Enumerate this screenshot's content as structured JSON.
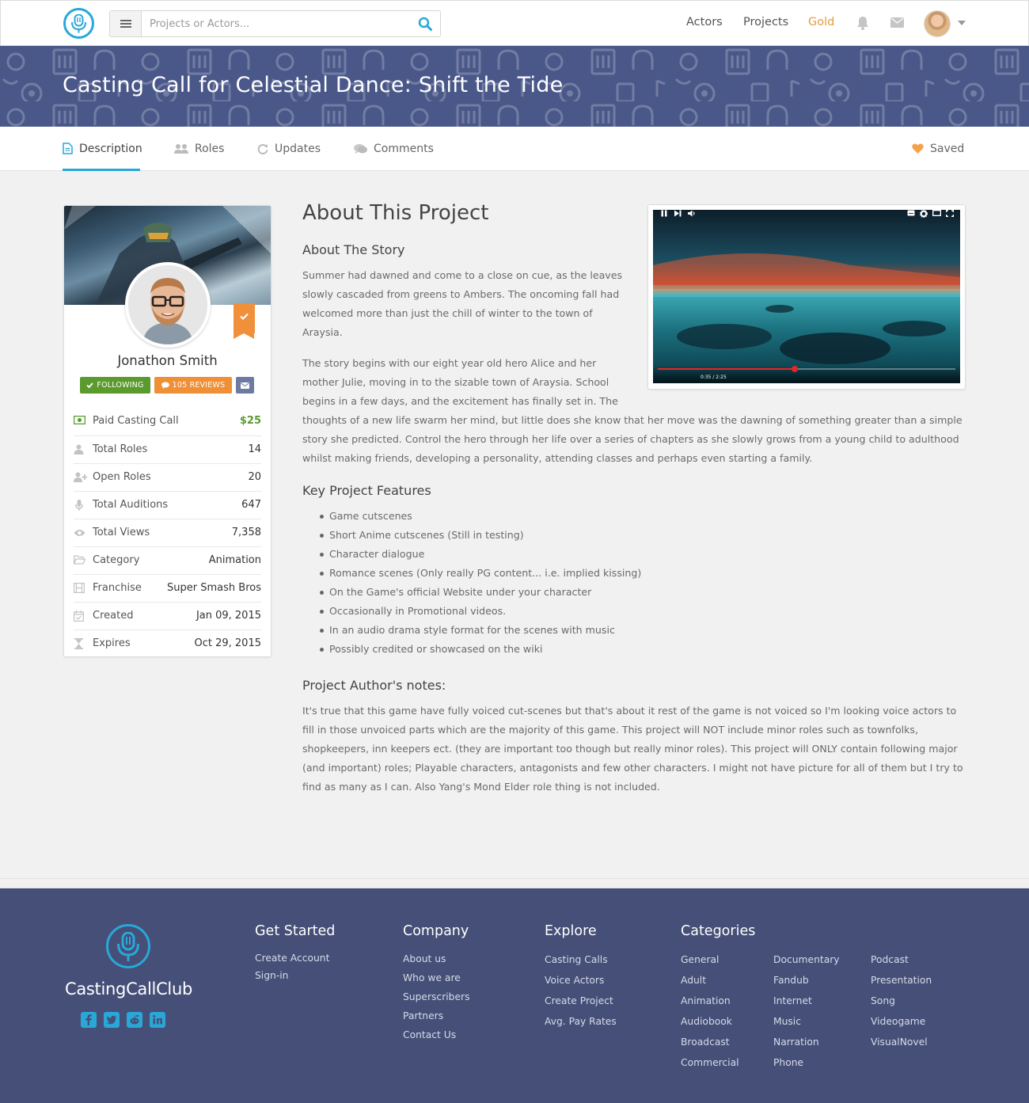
{
  "nav": {
    "search_placeholder": "Projects or Actors...",
    "links": [
      "Actors",
      "Projects",
      "Gold"
    ]
  },
  "banner": {
    "title": "Casting Call for Celestial Dance: Shift the Tide"
  },
  "tabs": [
    {
      "label": "Description",
      "icon": "file-icon",
      "active": true
    },
    {
      "label": "Roles",
      "icon": "users-icon",
      "active": false
    },
    {
      "label": "Updates",
      "icon": "refresh-icon",
      "active": false
    },
    {
      "label": "Comments",
      "icon": "comments-icon",
      "active": false
    }
  ],
  "saved_label": "Saved",
  "profile": {
    "name": "Jonathon Smith",
    "following_label": "FOLLOWING",
    "reviews_label": "105 REVIEWS",
    "stats": [
      {
        "icon": "money-icon",
        "label": "Paid Casting Call",
        "value": "$25"
      },
      {
        "icon": "user-icon",
        "label": "Total Roles",
        "value": "14"
      },
      {
        "icon": "user-plus-icon",
        "label": "Open Roles",
        "value": "20"
      },
      {
        "icon": "microphone-icon",
        "label": "Total Auditions",
        "value": "647"
      },
      {
        "icon": "eye-icon",
        "label": "Total Views",
        "value": "7,358"
      },
      {
        "icon": "folder-icon",
        "label": "Category",
        "value": "Animation"
      },
      {
        "icon": "film-icon",
        "label": "Franchise",
        "value": "Super Smash Bros"
      },
      {
        "icon": "calendar-icon",
        "label": "Created",
        "value": "Jan 09, 2015"
      },
      {
        "icon": "hourglass-icon",
        "label": "Expires",
        "value": "Oct 29, 2015"
      }
    ]
  },
  "content": {
    "title": "About This Project",
    "story_heading": "About The Story",
    "story_p1": "Summer had dawned and come to a close on cue, as the leaves slowly cascaded from greens to Ambers. The oncoming fall had welcomed more than just the chill of winter to the town of Araysia.",
    "story_p2": "The story begins with our eight year old hero Alice and her mother Julie, moving in to the sizable town of Araysia. School begins in a few days, and the excitement has finally set in. The thoughts of a new life swarm her mind, but little does she know that her move was the dawning of something greater than a simple story she predicted. Control the hero through her life over a series of chapters as she slowly grows from a young child to adulthood whilst making friends, developing a personality, attending classes and perhaps even starting a family.",
    "features_heading": "Key Project Features",
    "features": [
      "Game cutscenes",
      "Short Anime cutscenes (Still in testing)",
      "Character dialogue",
      "Romance scenes (Only really PG content... i.e. implied kissing)",
      "On the Game's official Website under your character",
      "Occasionally in Promotional videos.",
      "In an audio drama style format for the scenes with music",
      "Possibly credited or showcased on the wiki"
    ],
    "notes_heading": "Project Author's notes:",
    "notes": "It's true that this game have fully voiced cut-scenes but that's about it rest of the game is not voiced so I'm looking voice actors to fill in those unvoiced parts which are the majority of this game. This project will NOT include minor roles such as townfolks, shopkeepers, inn keepers ect. (they are important too though but really minor roles). This project will ONLY contain following major (and important) roles; Playable characters, antagonists and few other characters. I might not have picture for all of them but I try to find as many as I can. Also Yang's Mond Elder role thing is not included.",
    "video_time": "0:35 / 2:25",
    "video_progress": 0.46
  },
  "footer": {
    "brand": "CastingCallClub",
    "social": [
      "facebook-icon",
      "twitter-icon",
      "reddit-icon",
      "linkedin-icon"
    ],
    "columns": [
      {
        "heading": "Get Started",
        "links": [
          "Create Account",
          "Sign-in"
        ]
      },
      {
        "heading": "Company",
        "links": [
          "About us",
          "Who we are",
          "Superscribers",
          "Partners",
          "Contact Us"
        ]
      },
      {
        "heading": "Explore",
        "links": [
          "Casting Calls",
          "Voice Actors",
          "Create Project",
          "Avg. Pay Rates"
        ]
      },
      {
        "heading": "Categories",
        "links": [
          "General",
          "Adult",
          "Animation",
          "Audiobook",
          "Broadcast",
          "Commercial",
          "Documentary",
          "Fandub",
          "Internet",
          "Music",
          "Narration",
          "Phone",
          "Podcast",
          "Presentation",
          "Song",
          "Videogame",
          "VisualNovel"
        ]
      }
    ]
  },
  "colors": {
    "accent": "#29a8d8",
    "banner": "#4a5889",
    "footer": "#454f77",
    "gold": "#e89b3a",
    "following": "#5b9a2d",
    "reviews": "#ef8f36"
  }
}
